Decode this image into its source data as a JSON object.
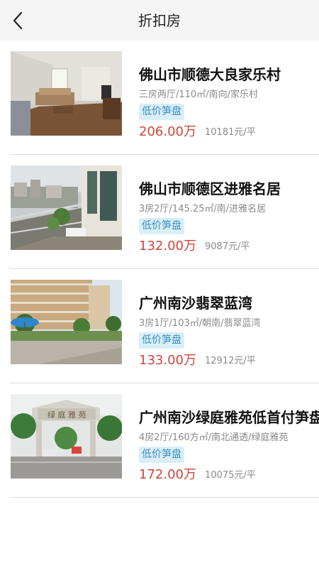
{
  "header": {
    "title": "折扣房",
    "back_icon": "chevron-left-icon"
  },
  "colors": {
    "price": "#d0453a",
    "tag_bg": "#d9eef7",
    "tag_text": "#3b8fc4",
    "header_bg": "#f5f5f5"
  },
  "listings": [
    {
      "name": "佛山市顺德大良家乐村",
      "info": "三房两厅/110㎡/南向/家乐村",
      "tag": "低价笋盘",
      "price": "206.00万",
      "unit_price": "10181元/平"
    },
    {
      "name": "佛山市顺德区进雅名居",
      "info": "3房2厅/145.25㎡/南/进雅名居",
      "tag": "低价笋盘",
      "price": "132.00万",
      "unit_price": "9087元/平"
    },
    {
      "name": "广州南沙翡翠蓝湾",
      "info": "3房1厅/103㎡/朝南/翡翠蓝湾",
      "tag": "低价笋盘",
      "price": "133.00万",
      "unit_price": "12912元/平"
    },
    {
      "name": "广州南沙绿庭雅苑低首付笋盘",
      "info": "4房2厅/160方㎡/南北通透/绿庭雅苑",
      "tag": "低价笋盘",
      "price": "172.00万",
      "unit_price": "10075元/平"
    }
  ]
}
